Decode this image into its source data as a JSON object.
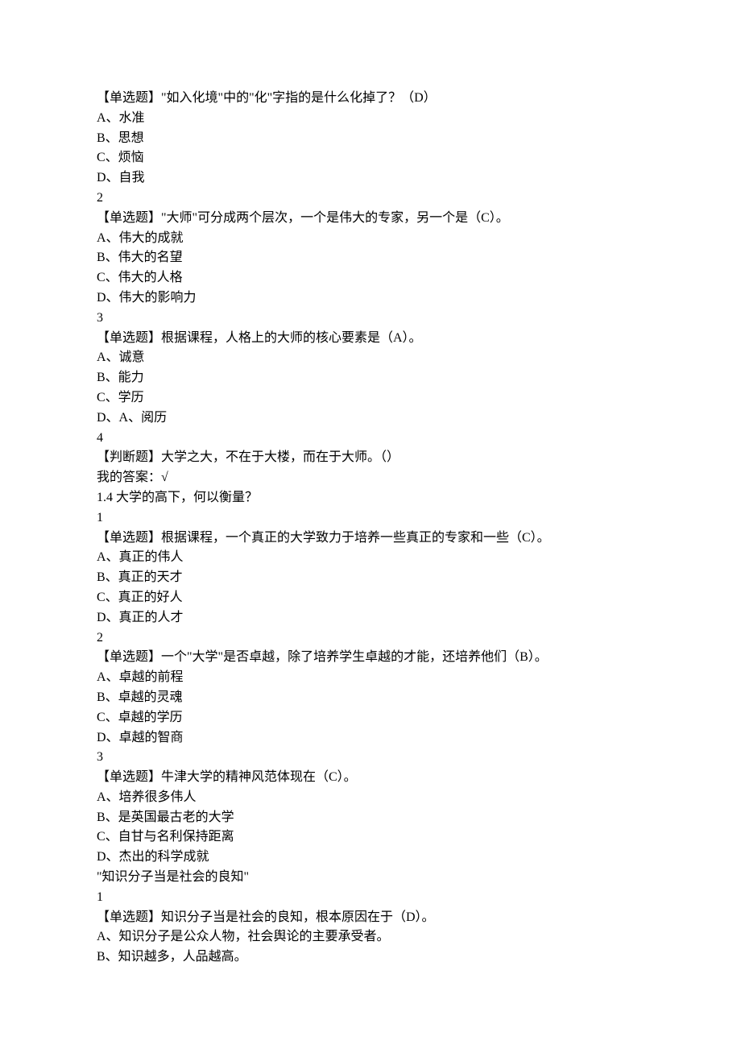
{
  "lines": [
    "【单选题】\"如入化境\"中的\"化\"字指的是什么化掉了？（D）",
    "A、水准",
    "B、思想",
    "C、烦恼",
    "D、自我",
    "2",
    "【单选题】\"大师\"可分成两个层次，一个是伟大的专家，另一个是（C）。",
    "A、伟大的成就",
    "B、伟大的名望",
    "C、伟大的人格",
    "D、伟大的影响力",
    "3",
    "【单选题】根据课程，人格上的大师的核心要素是（A）。",
    "A、诚意",
    "B、能力",
    "C、学历",
    "D、A、阅历",
    "4",
    "【判断题】大学之大，不在于大楼，而在于大师。（）",
    "我的答案：√",
    "1.4 大学的高下，何以衡量？",
    "1",
    "【单选题】根据课程，一个真正的大学致力于培养一些真正的专家和一些（C）。",
    "A、真正的伟人",
    "B、真正的天才",
    "C、真正的好人",
    "D、真正的人才",
    "2",
    "【单选题】一个\"大学\"是否卓越，除了培养学生卓越的才能，还培养他们（B）。",
    "A、卓越的前程",
    "B、卓越的灵魂",
    "C、卓越的学历",
    "D、卓越的智商",
    "3",
    "【单选题】牛津大学的精神风范体现在（C）。",
    "A、培养很多伟人",
    "B、是英国最古老的大学",
    "C、自甘与名利保持距离",
    "D、杰出的科学成就",
    "\"知识分子当是社会的良知\"",
    "1",
    "【单选题】知识分子当是社会的良知，根本原因在于（D）。",
    "A、知识分子是公众人物，社会舆论的主要承受者。",
    "B、知识越多，人品越高。"
  ]
}
